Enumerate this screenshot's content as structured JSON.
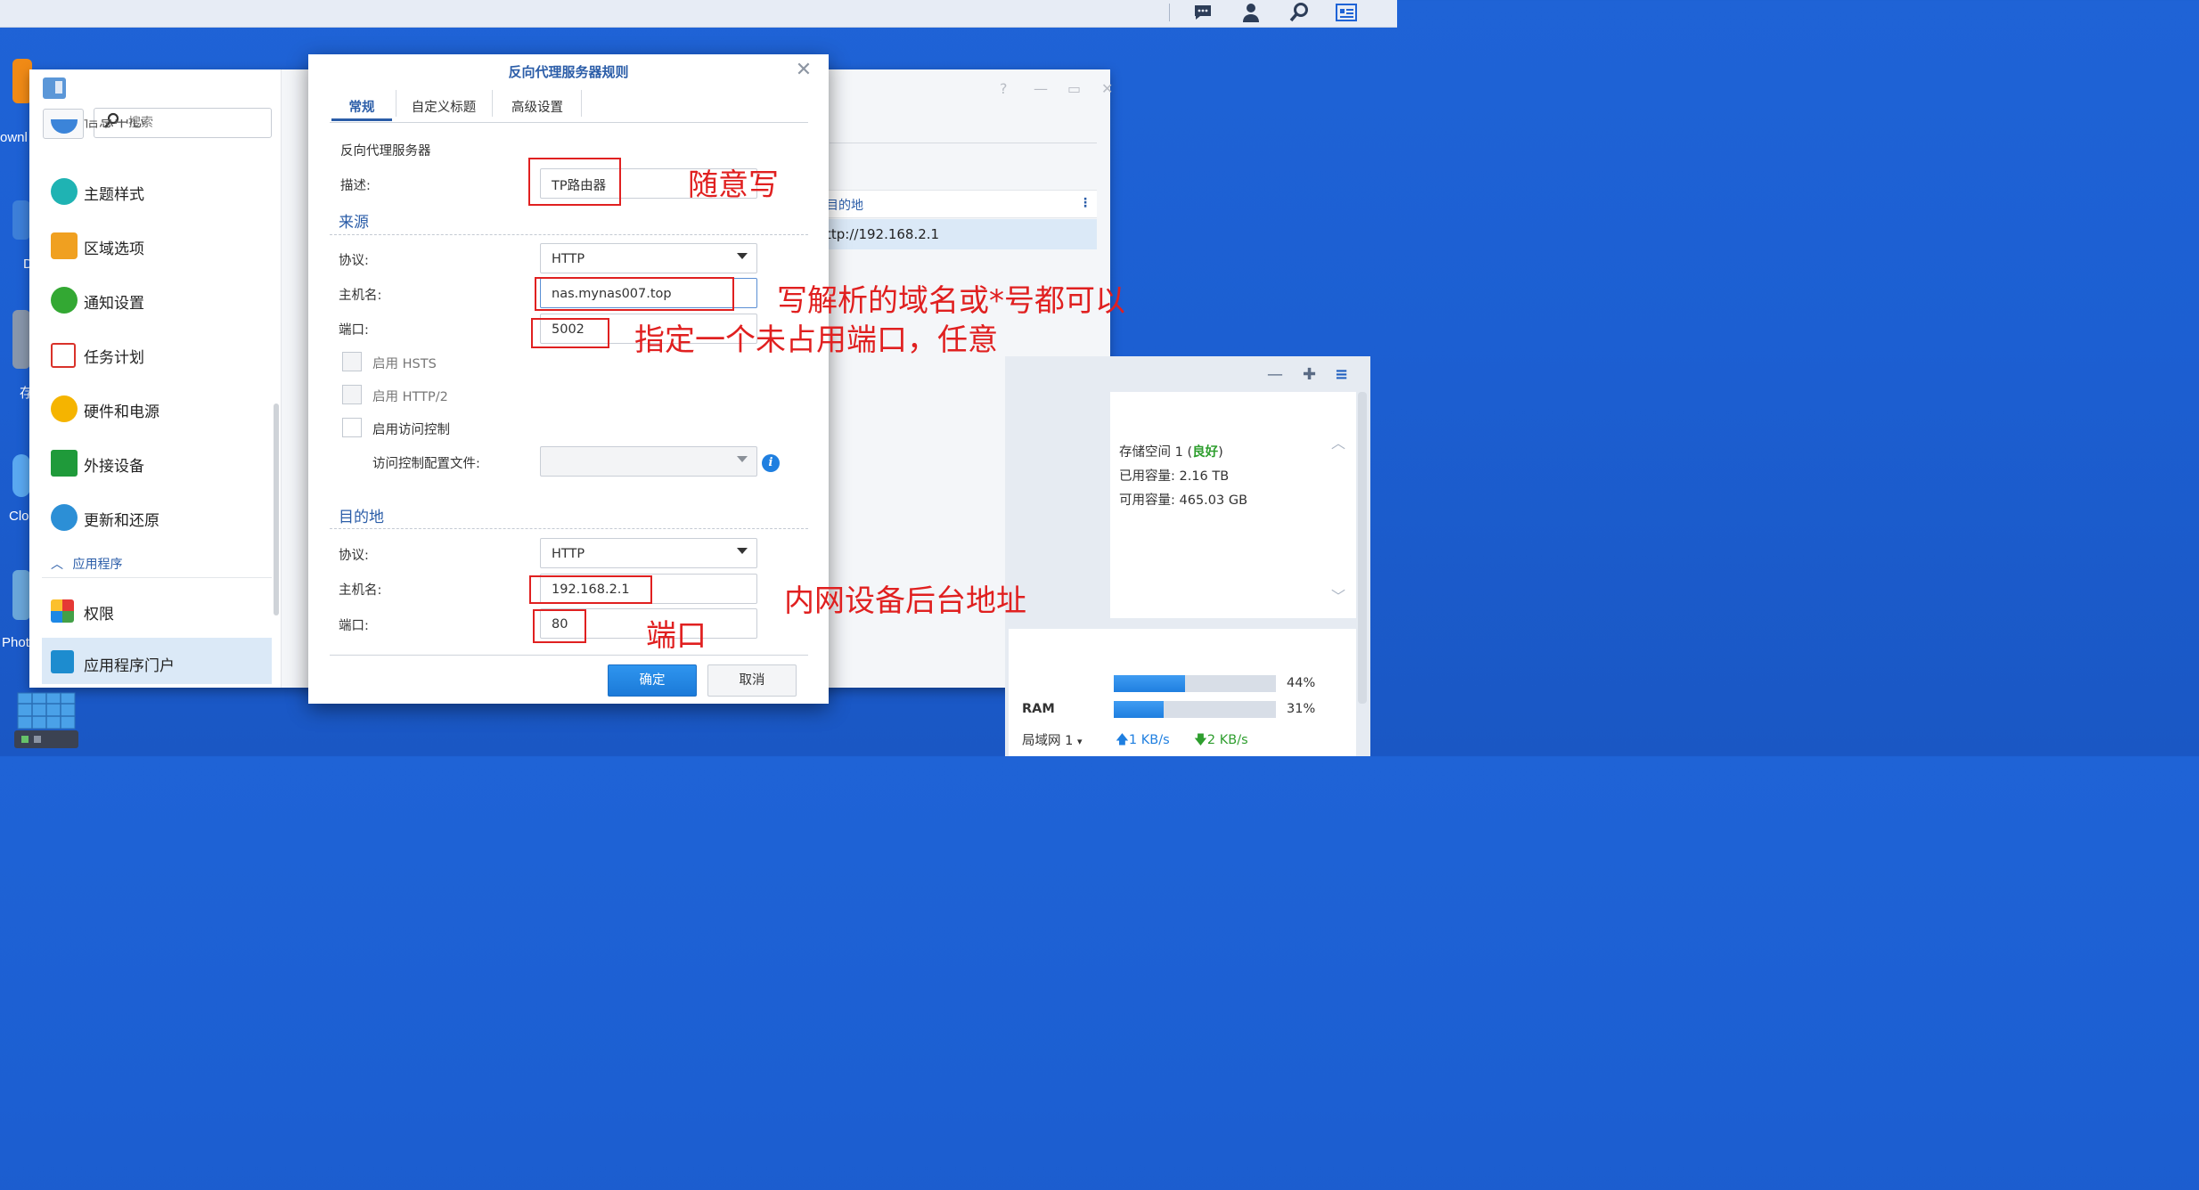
{
  "topbar": {
    "icons": [
      "chat-icon",
      "user-icon",
      "search-icon",
      "widgets-icon"
    ]
  },
  "desktop": {
    "labels": [
      "ownl",
      "D",
      "存",
      "Clo",
      "Phot"
    ]
  },
  "control_panel": {
    "search_placeholder": "搜索",
    "sidebar_partial_label": "信息中心",
    "sidebar_items": [
      {
        "label": "主题样式",
        "icon": "palette-icon"
      },
      {
        "label": "区域选项",
        "icon": "region-icon"
      },
      {
        "label": "通知设置",
        "icon": "notification-icon"
      },
      {
        "label": "任务计划",
        "icon": "task-icon"
      },
      {
        "label": "硬件和电源",
        "icon": "bulb-icon"
      },
      {
        "label": "外接设备",
        "icon": "external-device-icon"
      },
      {
        "label": "更新和还原",
        "icon": "update-icon"
      }
    ],
    "group_label": "应用程序",
    "group_items": [
      {
        "label": "权限",
        "icon": "permissions-icon"
      },
      {
        "label": "应用程序门户",
        "icon": "app-portal-icon",
        "active": true
      }
    ],
    "table": {
      "column_destination": "目的地",
      "row_destination": "ttp://192.168.2.1"
    }
  },
  "dialog": {
    "title": "反向代理服务器规则",
    "tabs": [
      "常规",
      "自定义标题",
      "高级设置"
    ],
    "section_general": "反向代理服务器",
    "description_label": "描述:",
    "description_value": "TP路由器",
    "source": {
      "title": "来源",
      "protocol_label": "协议:",
      "protocol_value": "HTTP",
      "hostname_label": "主机名:",
      "hostname_value": "nas.mynas007.top",
      "port_label": "端口:",
      "port_value": "5002"
    },
    "options": {
      "hsts": "启用 HSTS",
      "http2": "启用 HTTP/2",
      "access_control": "启用访问控制",
      "access_profile_label": "访问控制配置文件:"
    },
    "destination": {
      "title": "目的地",
      "protocol_label": "协议:",
      "protocol_value": "HTTP",
      "hostname_label": "主机名:",
      "hostname_value": "192.168.2.1",
      "port_label": "端口:",
      "port_value": "80"
    },
    "ok_label": "确定",
    "cancel_label": "取消"
  },
  "annotations": {
    "description": "随意写",
    "hostname": "写解析的域名或*号都可以",
    "port": "指定一个未占用端口，任意",
    "dest_hostname": "内网设备后台地址",
    "dest_port": "端口"
  },
  "widget": {
    "storage_prefix": "存储空间 1 (",
    "storage_status": "良好",
    "storage_suffix": ")",
    "used": "已用容量: 2.16 TB",
    "free": "可用容量: 465.03 GB",
    "cpu_percent": "44%",
    "cpu_fraction": 0.44,
    "ram_label": "RAM",
    "ram_percent": "31%",
    "ram_fraction": 0.31,
    "lan_label": "局域网 1",
    "upload": "1 KB/s",
    "download": "2 KB/s"
  },
  "colors": {
    "accent": "#2b5da8",
    "annotation_red": "#e02020",
    "ok_button": "#1f7fe0",
    "status_good": "#2e9e2e"
  }
}
